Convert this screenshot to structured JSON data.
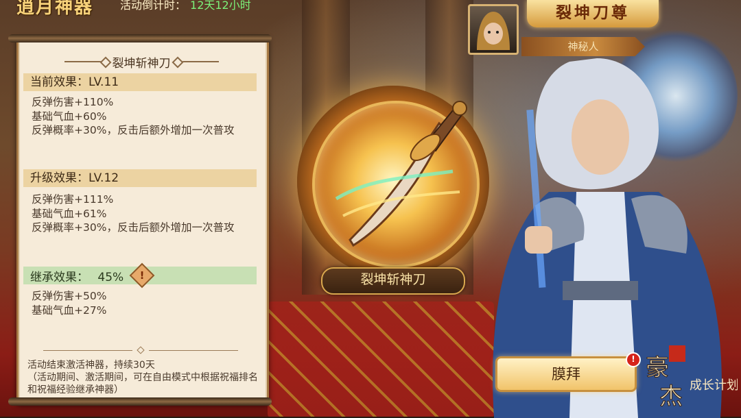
{
  "header": {
    "event_title": "逍月神器",
    "timer_label": "活动倒计时：",
    "timer_value": "12天12小时"
  },
  "panel": {
    "title": "裂坤斩神刀",
    "current": {
      "label": "当前效果：LV.11",
      "lines": [
        "反弹伤害+110%",
        "基础气血+60%",
        "反弹概率+30%，反击后额外增加一次普攻"
      ]
    },
    "upgrade": {
      "label": "升级效果：LV.12",
      "lines": [
        "反弹伤害+111%",
        "基础气血+61%",
        "反弹概率+30%，反击后额外增加一次普攻"
      ]
    },
    "inherit": {
      "label": "继承效果：",
      "percent": "45%",
      "badge_icon": "!",
      "lines": [
        "反弹伤害+50%",
        "基础气血+27%"
      ]
    },
    "footer": {
      "line1": "活动结束激活神器，持续30天",
      "line2": "（活动期间、激活期间，可在自由模式中根据祝福排名和祝福经验继承神器）"
    }
  },
  "weapon": {
    "name": "裂坤斩神刀"
  },
  "character": {
    "title": "裂坤刀尊",
    "name": "神秘人"
  },
  "actions": {
    "worship_label": "膜拜",
    "notice_mark": "!"
  },
  "logo": {
    "text": "豪杰成长计划"
  },
  "colors": {
    "current_bar": "#ecd3a2",
    "inherit_bar": "#c8e0b4",
    "timer_value": "#7cf27a",
    "panel_bg": "#f6ebd9"
  }
}
